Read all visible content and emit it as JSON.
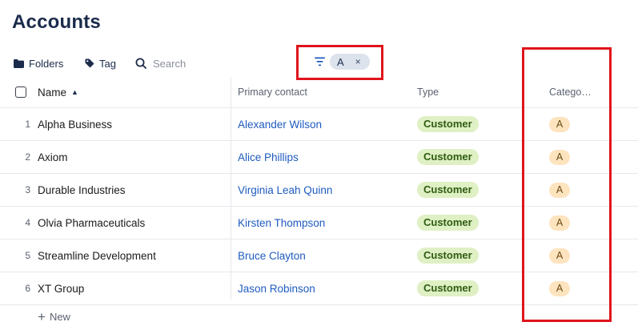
{
  "page": {
    "title": "Accounts"
  },
  "toolbar": {
    "folders_label": "Folders",
    "tag_label": "Tag",
    "search_placeholder": "Search",
    "filter_chip_label": "A",
    "filter_chip_close": "×"
  },
  "table": {
    "headers": {
      "name": "Name",
      "contact": "Primary contact",
      "type": "Type",
      "category": "Catego…"
    },
    "rows": [
      {
        "num": "1",
        "name": "Alpha Business",
        "contact": "Alexander Wilson",
        "type": "Customer",
        "category": "A"
      },
      {
        "num": "2",
        "name": "Axiom",
        "contact": "Alice Phillips",
        "type": "Customer",
        "category": "A"
      },
      {
        "num": "3",
        "name": "Durable Industries",
        "contact": "Virginia Leah Quinn",
        "type": "Customer",
        "category": "A"
      },
      {
        "num": "4",
        "name": "Olvia Pharmaceuticals",
        "contact": "Kirsten Thompson",
        "type": "Customer",
        "category": "A"
      },
      {
        "num": "5",
        "name": "Streamline Development",
        "contact": "Bruce Clayton",
        "type": "Customer",
        "category": "A"
      },
      {
        "num": "6",
        "name": "XT Group",
        "contact": "Jason Robinson",
        "type": "Customer",
        "category": "A"
      }
    ]
  },
  "footer": {
    "new_label": "New",
    "new_icon": "+"
  },
  "colors": {
    "accent": "#1f5bbf",
    "highlight": "#e0141c",
    "type_pill": "#dff0c4",
    "category_pill": "#fde4bf"
  }
}
